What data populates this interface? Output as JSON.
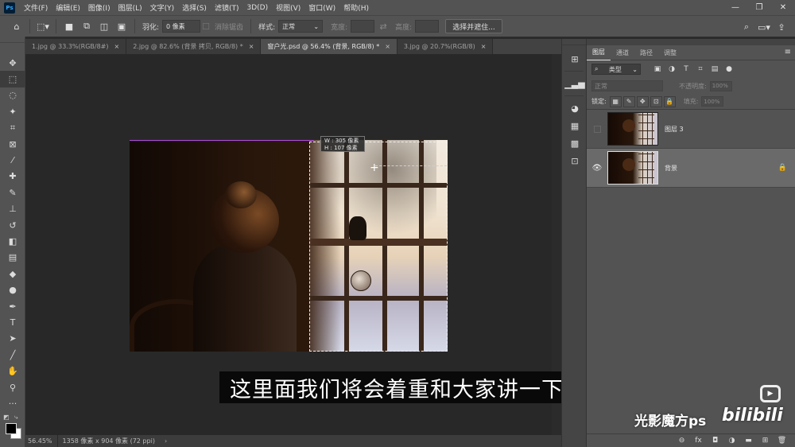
{
  "app": {
    "logo": "Ps"
  },
  "menu": [
    "文件(F)",
    "编辑(E)",
    "图像(I)",
    "图层(L)",
    "文字(Y)",
    "选择(S)",
    "滤镜(T)",
    "3D(D)",
    "视图(V)",
    "窗口(W)",
    "帮助(H)"
  ],
  "window_buttons": [
    "—",
    "❐",
    "✕"
  ],
  "options": {
    "feather_label": "羽化:",
    "feather_value": "0 像素",
    "antialias_label": "消除锯齿",
    "style_label": "样式:",
    "style_value": "正常",
    "width_label": "宽度:",
    "height_label": "高度:",
    "select_mask_button": "选择并遮住..."
  },
  "tabs": [
    {
      "label": "1.jpg @ 33.3%(RGB/8#)",
      "close": "×"
    },
    {
      "label": "2.jpg @ 82.6% (背景 拷贝, RGB/8) *",
      "close": "×"
    },
    {
      "label": "窗户光.psd @ 56.4% (背景, RGB/8) *",
      "close": "×"
    },
    {
      "label": "3.jpg @ 20.7%(RGB/8)",
      "close": "×"
    }
  ],
  "canvas": {
    "selection_hud_w": "W : 305 像素",
    "selection_hud_h": "H : 107 像素"
  },
  "status": {
    "zoom": "56.45%",
    "doc_info": "1358 像素 x 904 像素 (72 ppi)",
    "arrow": "›"
  },
  "subtitle": "这里面我们将会着重和大家讲一下",
  "layers_panel": {
    "tabs": [
      "图层",
      "通道",
      "路径",
      "调整"
    ],
    "filter_value": "类型",
    "blend_mode": "正常",
    "opacity_label": "不透明度:",
    "opacity_value": "100%",
    "lock_label": "锁定:",
    "fill_label": "填充:",
    "fill_value": "100%",
    "layers": [
      {
        "name": "图层 3",
        "visible": false,
        "selected": false
      },
      {
        "name": "背景",
        "visible": true,
        "selected": true,
        "locked": true
      }
    ]
  },
  "watermark": {
    "channel": "光影魔方ps",
    "site": "bilibili"
  }
}
